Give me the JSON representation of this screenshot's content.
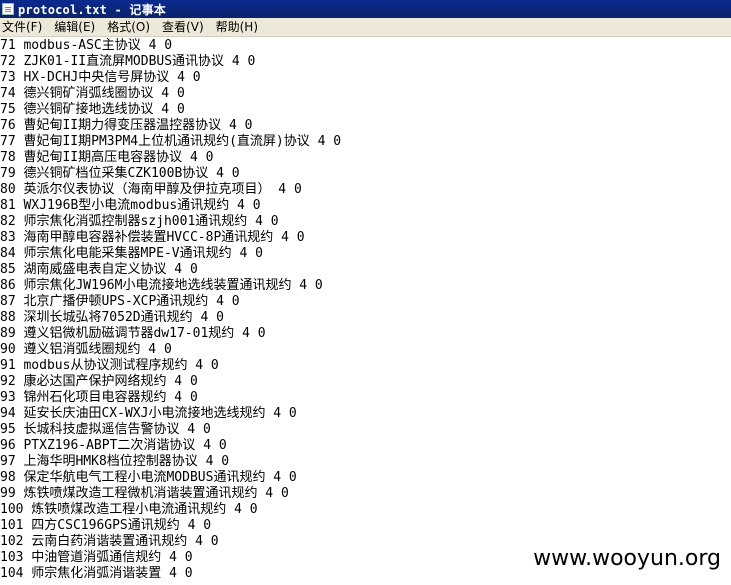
{
  "window": {
    "title": "protocol.txt - 记事本",
    "icon": "notepad-icon"
  },
  "menu": [
    "文件(F)",
    "编辑(E)",
    "格式(O)",
    "查看(V)",
    "帮助(H)"
  ],
  "lines": [
    "71 modbus-ASC主协议 4 0",
    "72 ZJK01-II直流屏MODBUS通讯协议 4 0",
    "73 HX-DCHJ中央信号屏协议 4 0",
    "74 德兴铜矿消弧线圈协议 4 0",
    "75 德兴铜矿接地选线协议 4 0",
    "76 曹妃甸II期力得变压器温控器协议 4 0",
    "77 曹妃甸II期PM3PM4上位机通讯规约(直流屏)协议 4 0",
    "78 曹妃甸II期高压电容器协议 4 0",
    "79 德兴铜矿档位采集CZK100B协议 4 0",
    "80 英派尔仪表协议（海南甲醇及伊拉克项目） 4 0",
    "81 WXJ196B型小电流modbus通讯规约 4 0",
    "82 师宗焦化消弧控制器szjh001通讯规约 4 0",
    "83 海南甲醇电容器补偿装置HVCC-8P通讯规约 4 0",
    "84 师宗焦化电能采集器MPE-V通讯规约 4 0",
    "85 湖南威盛电表自定义协议 4 0",
    "86 师宗焦化JW196M小电流接地选线装置通讯规约 4 0",
    "87 北京广播伊顿UPS-XCP通讯规约 4 0",
    "88 深圳长城弘将7052D通讯规约 4 0",
    "89 遵义铝微机励磁调节器dw17-01规约 4 0",
    "90 遵义铝消弧线圈规约 4 0",
    "91 modbus从协议测试程序规约 4 0",
    "92 康必达国产保护网络规约 4 0",
    "93 锦州石化项目电容器规约 4 0",
    "94 延安长庆油田CX-WXJ小电流接地选线规约 4 0",
    "95 长城科技虚拟遥信告警协议 4 0",
    "96 PTXZ196-ABPT二次消谐协议 4 0",
    "97 上海华明HMK8档位控制器协议 4 0",
    "98 保定华航电气工程小电流MODBUS通讯规约 4 0",
    "99 炼铁喷煤改造工程微机消谐装置通讯规约 4 0",
    "100 炼铁喷煤改造工程小电流通讯规约 4 0",
    "101 四方CSC196GPS通讯规约 4 0",
    "102 云南白药消谐装置通讯规约 4 0",
    "103 中油管道消弧通信规约 4 0",
    "104 师宗焦化消弧消谐装置 4 0"
  ],
  "watermark": "www.wooyun.org"
}
